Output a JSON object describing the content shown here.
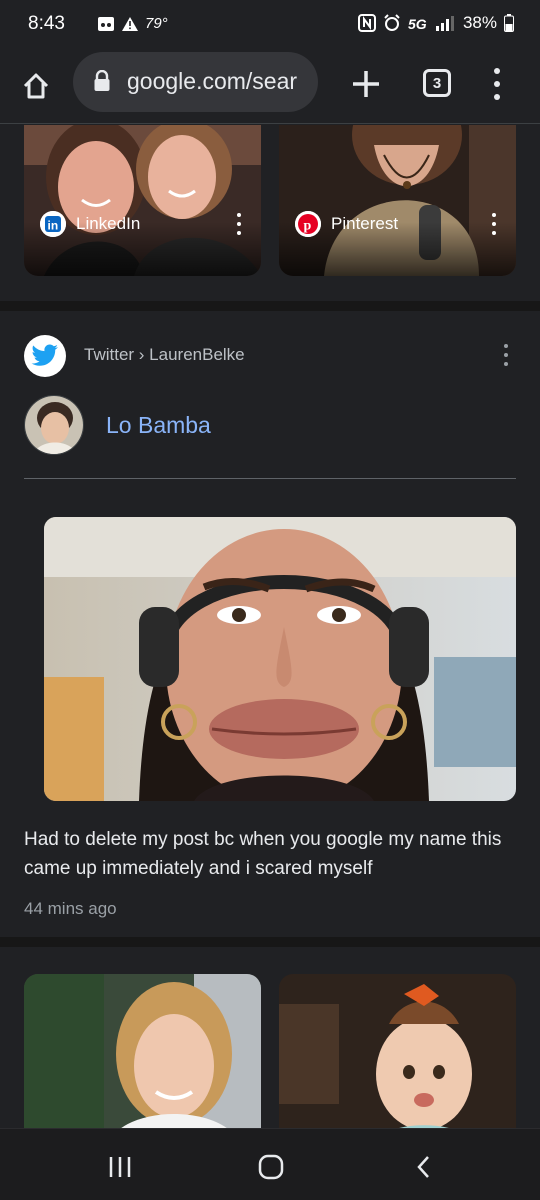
{
  "status_bar": {
    "time": "8:43",
    "temperature": "79°",
    "battery": "38%"
  },
  "browser": {
    "url": "google.com/sear",
    "tab_count": "3"
  },
  "top_images": [
    {
      "source": "LinkedIn",
      "icon": "linkedin-icon"
    },
    {
      "source": "Pinterest",
      "icon": "pinterest-icon"
    }
  ],
  "result": {
    "breadcrumb": "Twitter › LaurenBelke",
    "title": "Lo Bamba",
    "tweet_text": "Had to delete my post bc when you google my name this came up immediately and i scared myself",
    "timestamp": "44 mins ago"
  },
  "colors": {
    "background": "#202124",
    "link_blue": "#8ab4f8",
    "twitter_blue": "#1da1f2"
  }
}
